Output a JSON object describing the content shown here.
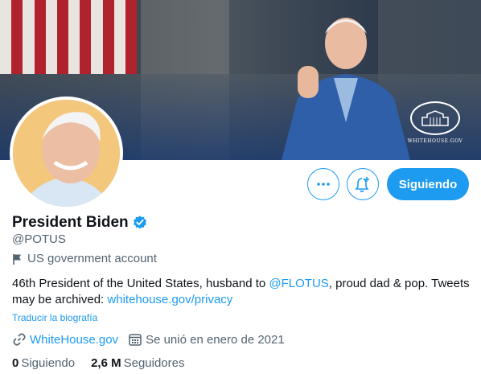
{
  "banner": {
    "logo_text": "WHITEHOUSE.GOV"
  },
  "profile": {
    "name": "President Biden",
    "handle": "@POTUS",
    "account_label": "US government account",
    "bio_part1": "46th President of the United States, husband to ",
    "bio_mention": "@FLOTUS",
    "bio_part2": ", proud dad & pop. Tweets may be archived: ",
    "bio_link": "whitehouse.gov/privacy",
    "translate": "Traducir la biografía",
    "website": "WhiteHouse.gov",
    "joined": "Se unió en enero de 2021"
  },
  "actions": {
    "follow_label": "Siguiendo"
  },
  "stats": {
    "following_count": "0",
    "following_label": "Siguiendo",
    "followers_count": "2,6 M",
    "followers_label": "Seguidores"
  },
  "colors": {
    "accent": "#1d9bf0",
    "text": "#0f1419",
    "muted": "#536471"
  }
}
